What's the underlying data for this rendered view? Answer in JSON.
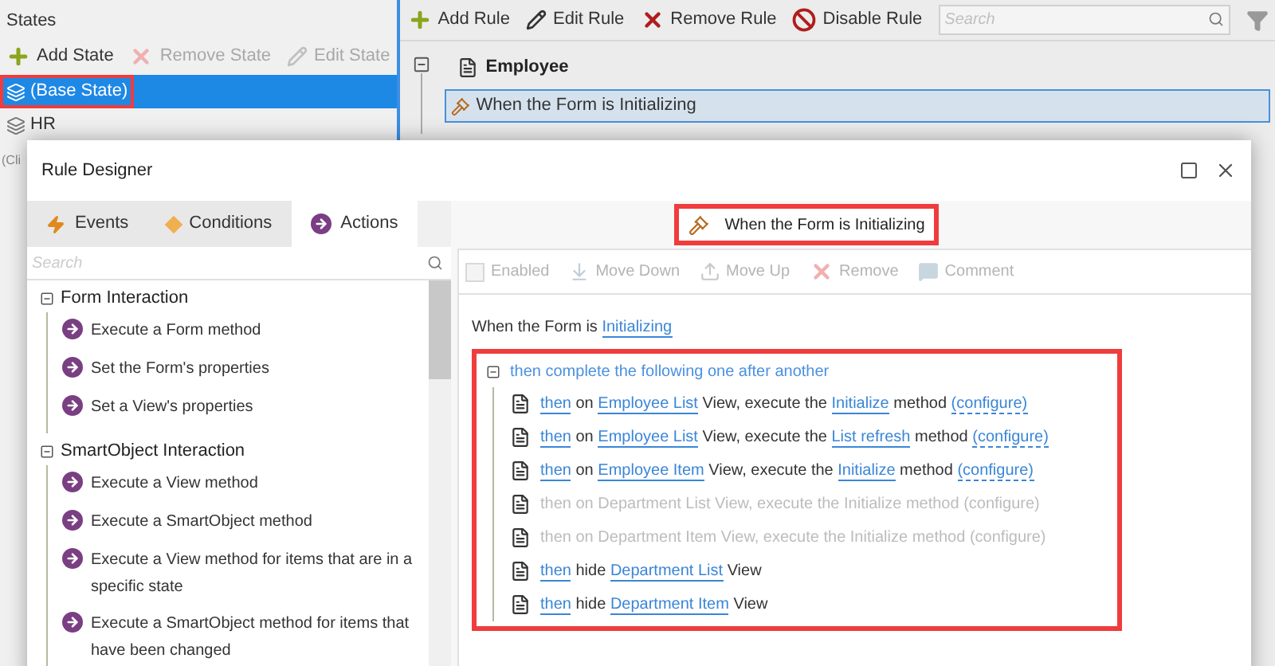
{
  "states_panel": {
    "title": "States",
    "toolbar": [
      {
        "label": "Add State",
        "kind": "add",
        "disabled": false
      },
      {
        "label": "Remove State",
        "kind": "remove",
        "disabled": true
      },
      {
        "label": "Edit State",
        "kind": "edit",
        "disabled": true
      }
    ],
    "items": [
      {
        "label": "(Base State)",
        "selected": true,
        "highlighted": true
      },
      {
        "label": "HR",
        "selected": false,
        "highlighted": false
      }
    ],
    "cut_text": "(Cli"
  },
  "rules_panel": {
    "toolbar": [
      {
        "label": "Add Rule",
        "kind": "add"
      },
      {
        "label": "Edit Rule",
        "kind": "edit"
      },
      {
        "label": "Remove Rule",
        "kind": "remove"
      },
      {
        "label": "Disable Rule",
        "kind": "disable"
      }
    ],
    "search": {
      "placeholder": "Search"
    },
    "tree": {
      "label": "Employee",
      "expanded": true,
      "children": [
        {
          "label": "When the Form is Initializing",
          "selected": true
        }
      ]
    }
  },
  "dialog": {
    "title": "Rule Designer",
    "tabs": [
      {
        "label": "Events",
        "kind": "events",
        "selected": false
      },
      {
        "label": "Conditions",
        "kind": "conditions",
        "selected": false
      },
      {
        "label": "Actions",
        "kind": "actions",
        "selected": true
      }
    ],
    "search": {
      "placeholder": "Search"
    },
    "groups": [
      {
        "label": "Form Interaction",
        "expanded": true,
        "children": [
          {
            "label": "Execute a Form method"
          },
          {
            "label": "Set the Form's properties"
          },
          {
            "label": "Set a View's properties"
          }
        ]
      },
      {
        "label": "SmartObject Interaction",
        "expanded": true,
        "children": [
          {
            "label": "Execute a View method"
          },
          {
            "label": "Execute a SmartObject method"
          },
          {
            "label": "Execute a View method for items that are in a specific state"
          },
          {
            "label": "Execute a SmartObject method for items that have been changed"
          }
        ]
      }
    ],
    "rule_title": {
      "label": "When the Form is Initializing",
      "highlighted": true
    },
    "toolbar": [
      {
        "label": "Enabled",
        "kind": "checkbox",
        "disabled": true
      },
      {
        "label": "Move Down",
        "kind": "down",
        "disabled": true
      },
      {
        "label": "Move Up",
        "kind": "up",
        "disabled": true
      },
      {
        "label": "Remove",
        "kind": "remove",
        "disabled": true
      },
      {
        "label": "Comment",
        "kind": "comment",
        "disabled": true
      }
    ],
    "event_line": [
      {
        "text": "When the Form is",
        "kind": "text"
      },
      {
        "text": "Initializing",
        "kind": "link"
      }
    ],
    "block": {
      "label": "then complete the following one after another",
      "expanded": true,
      "highlighted": true,
      "actions": [
        {
          "disabled": false,
          "parts": [
            {
              "text": "then",
              "kind": "link"
            },
            {
              "text": "on",
              "kind": "text"
            },
            {
              "text": "Employee List",
              "kind": "link"
            },
            {
              "text": "View, execute the",
              "kind": "text"
            },
            {
              "text": "Initialize",
              "kind": "link"
            },
            {
              "text": "method",
              "kind": "text"
            },
            {
              "text": "(configure)",
              "kind": "configure"
            }
          ]
        },
        {
          "disabled": false,
          "parts": [
            {
              "text": "then",
              "kind": "link"
            },
            {
              "text": "on",
              "kind": "text"
            },
            {
              "text": "Employee List",
              "kind": "link"
            },
            {
              "text": "View, execute the",
              "kind": "text"
            },
            {
              "text": "List refresh",
              "kind": "link"
            },
            {
              "text": "method",
              "kind": "text"
            },
            {
              "text": "(configure)",
              "kind": "configure"
            }
          ]
        },
        {
          "disabled": false,
          "parts": [
            {
              "text": "then",
              "kind": "link"
            },
            {
              "text": "on",
              "kind": "text"
            },
            {
              "text": "Employee Item",
              "kind": "link"
            },
            {
              "text": "View, execute the",
              "kind": "text"
            },
            {
              "text": "Initialize",
              "kind": "link"
            },
            {
              "text": "method",
              "kind": "text"
            },
            {
              "text": "(configure)",
              "kind": "configure"
            }
          ]
        },
        {
          "disabled": true,
          "parts": [
            {
              "text": "then",
              "kind": "link"
            },
            {
              "text": "on",
              "kind": "text"
            },
            {
              "text": "Department List",
              "kind": "link"
            },
            {
              "text": "View, execute the",
              "kind": "text"
            },
            {
              "text": "Initialize",
              "kind": "link"
            },
            {
              "text": "method",
              "kind": "text"
            },
            {
              "text": "(configure)",
              "kind": "configure"
            }
          ]
        },
        {
          "disabled": true,
          "parts": [
            {
              "text": "then",
              "kind": "link"
            },
            {
              "text": "on",
              "kind": "text"
            },
            {
              "text": "Department Item",
              "kind": "link"
            },
            {
              "text": "View, execute the",
              "kind": "text"
            },
            {
              "text": "Initialize",
              "kind": "link"
            },
            {
              "text": "method",
              "kind": "text"
            },
            {
              "text": "(configure)",
              "kind": "configure"
            }
          ]
        },
        {
          "disabled": false,
          "parts": [
            {
              "text": "then",
              "kind": "link"
            },
            {
              "text": "hide",
              "kind": "text"
            },
            {
              "text": "Department List",
              "kind": "link"
            },
            {
              "text": "View",
              "kind": "text"
            }
          ]
        },
        {
          "disabled": false,
          "parts": [
            {
              "text": "then",
              "kind": "link"
            },
            {
              "text": "hide",
              "kind": "text"
            },
            {
              "text": "Department Item",
              "kind": "link"
            },
            {
              "text": "View",
              "kind": "text"
            }
          ]
        }
      ]
    }
  }
}
